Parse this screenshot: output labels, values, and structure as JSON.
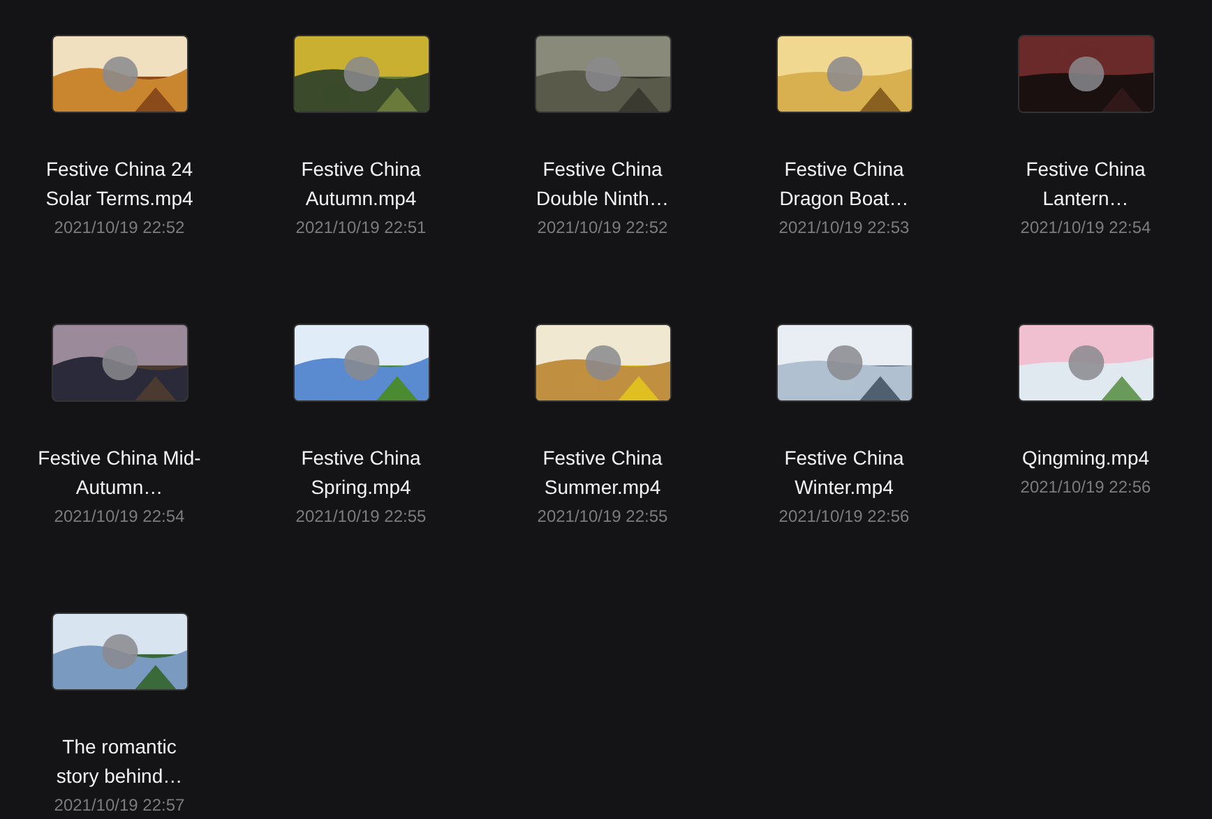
{
  "files": [
    {
      "name": "Festive China 24\nSolar Terms.mp4",
      "date": "2021/10/19 22:52"
    },
    {
      "name": "Festive China\nAutumn.mp4",
      "date": "2021/10/19 22:51"
    },
    {
      "name": "Festive China\nDouble Ninth…",
      "date": "2021/10/19 22:52"
    },
    {
      "name": "Festive China\nDragon Boat…",
      "date": "2021/10/19 22:53"
    },
    {
      "name": "Festive China\nLantern…",
      "date": "2021/10/19 22:54"
    },
    {
      "name": "Festive China Mid-\nAutumn…",
      "date": "2021/10/19 22:54"
    },
    {
      "name": "Festive China\nSpring.mp4",
      "date": "2021/10/19 22:55"
    },
    {
      "name": "Festive China\nSummer.mp4",
      "date": "2021/10/19 22:55"
    },
    {
      "name": "Festive China\nWinter.mp4",
      "date": "2021/10/19 22:56"
    },
    {
      "name": "Qingming.mp4",
      "date": "2021/10/19 22:56"
    },
    {
      "name": "The romantic\nstory behind…",
      "date": "2021/10/19 22:57"
    }
  ]
}
